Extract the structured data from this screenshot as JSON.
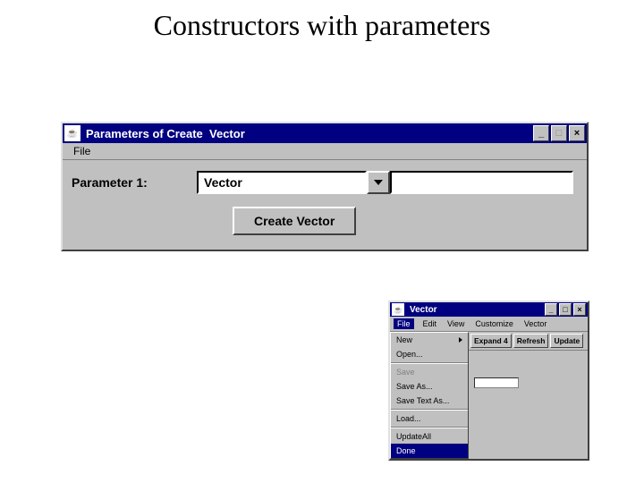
{
  "slide": {
    "title": "Constructors with parameters"
  },
  "win1": {
    "title": "Parameters of Create  Vector",
    "menubar": {
      "file": "File"
    },
    "param_label": "Parameter 1:",
    "param_value": "Vector",
    "create_btn": "Create Vector"
  },
  "win2": {
    "title": "Vector",
    "menubar": [
      "File",
      "Edit",
      "View",
      "Customize",
      "Vector"
    ],
    "toolbar": [
      "Expand 4",
      "Refresh",
      "Update"
    ],
    "filemenu": [
      {
        "label": "New",
        "submenu": true,
        "disabled": false
      },
      {
        "label": "Open...",
        "disabled": false
      },
      {
        "label": "Save",
        "disabled": true
      },
      {
        "label": "Save As...",
        "disabled": false
      },
      {
        "label": "Save Text As...",
        "disabled": false
      },
      {
        "label": "Load...",
        "disabled": false
      },
      {
        "label": "UpdateAll",
        "disabled": false
      },
      {
        "label": "Done",
        "selected": true
      }
    ]
  }
}
